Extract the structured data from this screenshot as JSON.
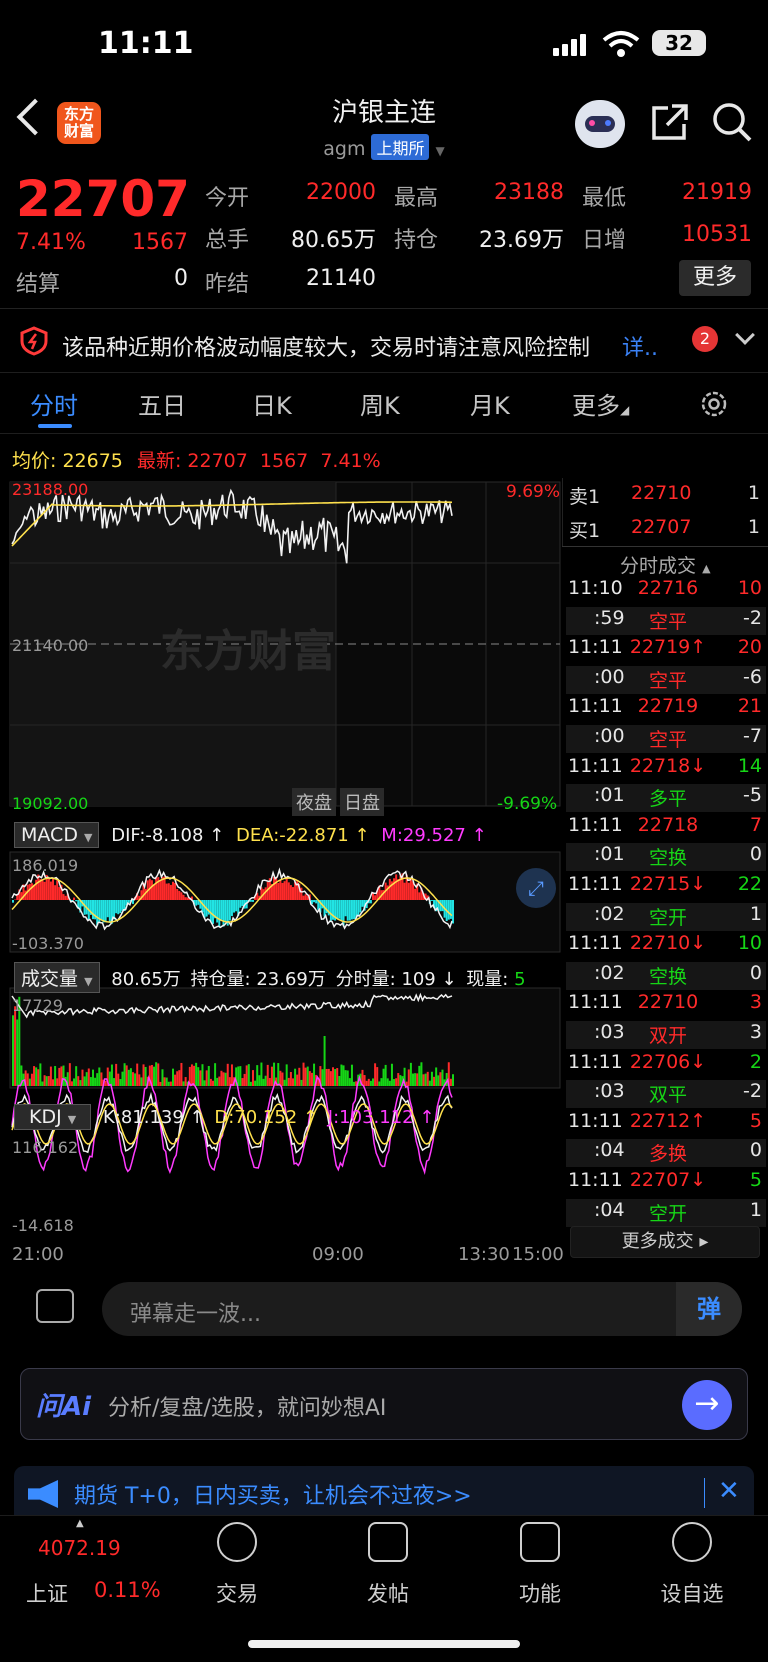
{
  "status_bar": {
    "time": "11:11",
    "battery": "32"
  },
  "header": {
    "title": "沪银主连",
    "code": "agm",
    "exchange": "上期所",
    "logo_text": "东方\n财富"
  },
  "quote": {
    "price": "22707",
    "change_pct": "7.41%",
    "change": "1567",
    "settle_label": "结算",
    "settle_value": "0",
    "open_label": "今开",
    "open_value": "22000",
    "high_label": "最高",
    "high_value": "23188",
    "low_label": "最低",
    "low_value": "21919",
    "volume_label": "总手",
    "volume_value": "80.65万",
    "oi_label": "持仓",
    "oi_value": "23.69万",
    "daily_inc_label": "日增",
    "daily_inc_value": "10531",
    "prev_settle_label": "昨结",
    "prev_settle_value": "21140",
    "more_label": "更多"
  },
  "risk": {
    "text": "该品种近期价格波动幅度较大，交易时请注意风险控制",
    "detail": "详",
    "count": "2"
  },
  "tabs": [
    "分时",
    "五日",
    "日K",
    "周K",
    "月K",
    "更多"
  ],
  "chart_info": {
    "avg_label": "均价:",
    "avg_value": "22675",
    "latest_label": "最新:",
    "latest_value": "22707",
    "change": "1567",
    "change_pct": "7.41%"
  },
  "chart_axes": {
    "high": "23188.00",
    "mid": "21140.00",
    "low": "19092.00",
    "high_pct": "9.69%",
    "low_pct": "-9.69%",
    "session_night": "夜盘",
    "session_day": "日盘",
    "time_ticks": [
      "21:00",
      "09:00",
      "13:30",
      "15:00"
    ]
  },
  "macd": {
    "label": "MACD",
    "dif": "DIF:-8.108 ↑",
    "dea": "DEA:-22.871 ↑",
    "m": "M:29.527 ↑",
    "top": "186.019",
    "bottom": "-103.370"
  },
  "volume": {
    "label": "成交量",
    "total": "80.65万",
    "oi": "持仓量: 23.69万",
    "tick": "分时量: 109 ↓",
    "now_label": "现量:",
    "now_value": "5",
    "top": "17729"
  },
  "kdj": {
    "label": "KDJ",
    "k": "K:81.139 ↑",
    "d": "D:70.152 ↑",
    "j": "J:103.112 ↑",
    "top": "116.162",
    "bottom": "-14.618"
  },
  "order_book": {
    "sell_label": "卖1",
    "sell_price": "22710",
    "sell_vol": "1",
    "buy_label": "买1",
    "buy_price": "22707",
    "buy_vol": "1"
  },
  "trades_header": "分时成交",
  "trades": [
    {
      "time": "11:10",
      "price": "22716",
      "vol": "10",
      "pc": "red",
      "vc": "red"
    },
    {
      "time": ":59",
      "price": "空平",
      "vol": "-2",
      "pc": "red",
      "vc": "white"
    },
    {
      "time": "11:11",
      "price": "22719↑",
      "vol": "20",
      "pc": "red",
      "vc": "red"
    },
    {
      "time": ":00",
      "price": "空平",
      "vol": "-6",
      "pc": "red",
      "vc": "white"
    },
    {
      "time": "11:11",
      "price": "22719",
      "vol": "21",
      "pc": "red",
      "vc": "red"
    },
    {
      "time": ":00",
      "price": "空平",
      "vol": "-7",
      "pc": "red",
      "vc": "white"
    },
    {
      "time": "11:11",
      "price": "22718↓",
      "vol": "14",
      "pc": "red",
      "vc": "green"
    },
    {
      "time": ":01",
      "price": "多平",
      "vol": "-5",
      "pc": "green",
      "vc": "white"
    },
    {
      "time": "11:11",
      "price": "22718",
      "vol": "7",
      "pc": "red",
      "vc": "red"
    },
    {
      "time": ":01",
      "price": "空换",
      "vol": "0",
      "pc": "green",
      "vc": "white"
    },
    {
      "time": "11:11",
      "price": "22715↓",
      "vol": "22",
      "pc": "red",
      "vc": "green"
    },
    {
      "time": ":02",
      "price": "空开",
      "vol": "1",
      "pc": "green",
      "vc": "white"
    },
    {
      "time": "11:11",
      "price": "22710↓",
      "vol": "10",
      "pc": "red",
      "vc": "green"
    },
    {
      "time": ":02",
      "price": "空换",
      "vol": "0",
      "pc": "green",
      "vc": "white"
    },
    {
      "time": "11:11",
      "price": "22710",
      "vol": "3",
      "pc": "red",
      "vc": "red"
    },
    {
      "time": ":03",
      "price": "双开",
      "vol": "3",
      "pc": "red",
      "vc": "white"
    },
    {
      "time": "11:11",
      "price": "22706↓",
      "vol": "2",
      "pc": "red",
      "vc": "green"
    },
    {
      "time": ":03",
      "price": "双平",
      "vol": "-2",
      "pc": "green",
      "vc": "white"
    },
    {
      "time": "11:11",
      "price": "22712↑",
      "vol": "5",
      "pc": "red",
      "vc": "red"
    },
    {
      "time": ":04",
      "price": "多换",
      "vol": "0",
      "pc": "red",
      "vc": "white"
    },
    {
      "time": "11:11",
      "price": "22707↓",
      "vol": "5",
      "pc": "red",
      "vc": "green"
    },
    {
      "time": ":04",
      "price": "空开",
      "vol": "1",
      "pc": "green",
      "vc": "white"
    }
  ],
  "more_trades": "更多成交 ▸",
  "watermark": "东方财富",
  "danmu": {
    "placeholder": "弹幕走一波...",
    "send": "弹"
  },
  "ai": {
    "logo": "问Ai",
    "placeholder": "分析/复盘/选股，就问妙想AI"
  },
  "promo": {
    "text": "期货 T+0，日内买卖，让机会不过夜>>"
  },
  "bottom_nav": {
    "index_value": "4072.19",
    "index_name": "上证",
    "index_pct": "0.11%",
    "trade": "交易",
    "post": "发帖",
    "functions": "功能",
    "watchlist": "设自选"
  },
  "colors": {
    "up": "#ff2a2a",
    "down": "#16d616",
    "accent": "#3b8cff",
    "avg_line": "#ffe14d",
    "j_line": "#ff3bff"
  }
}
